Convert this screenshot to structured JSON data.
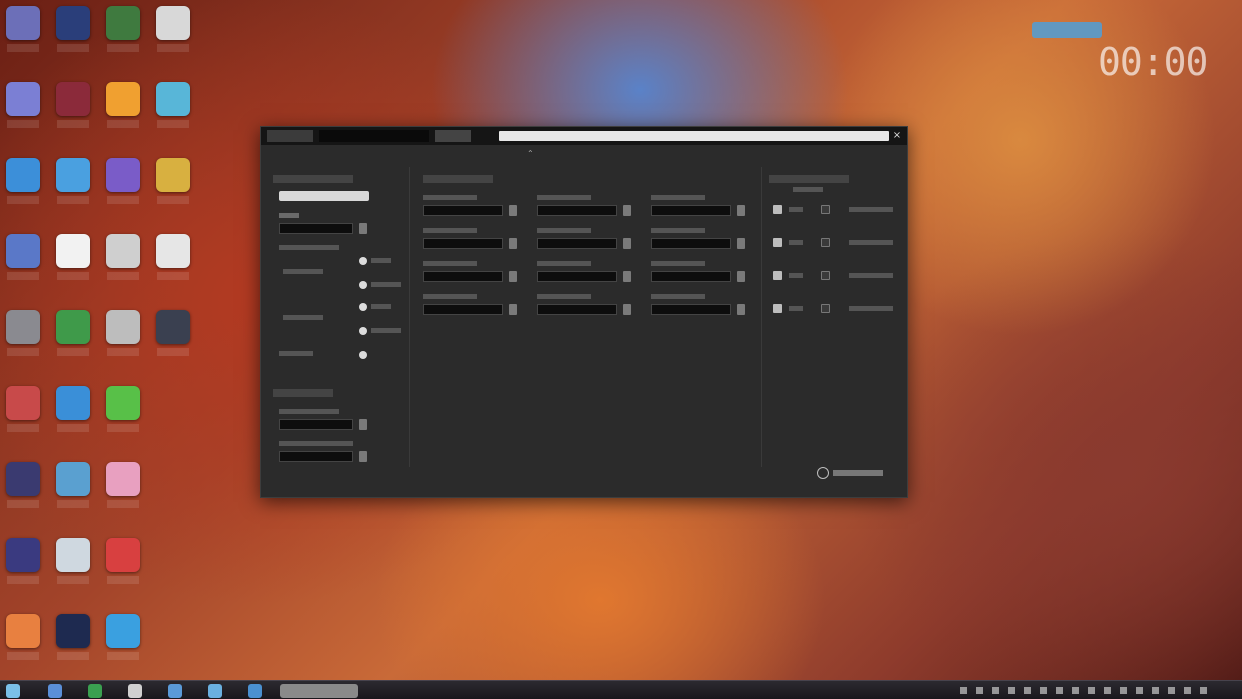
{
  "desktop": {
    "icons": [
      {
        "col": 0,
        "row": 0,
        "color": "#6c6fb8"
      },
      {
        "col": 1,
        "row": 0,
        "color": "#2a3e7a"
      },
      {
        "col": 2,
        "row": 0,
        "color": "#3f7a3f"
      },
      {
        "col": 3,
        "row": 0,
        "color": "#d8d8d8"
      },
      {
        "col": 0,
        "row": 1,
        "color": "#7b7fd4"
      },
      {
        "col": 1,
        "row": 1,
        "color": "#8b2a3a"
      },
      {
        "col": 2,
        "row": 1,
        "color": "#f0a030"
      },
      {
        "col": 3,
        "row": 1,
        "color": "#58b6d8"
      },
      {
        "col": 0,
        "row": 2,
        "color": "#3c8fd9"
      },
      {
        "col": 1,
        "row": 2,
        "color": "#4aa0e0"
      },
      {
        "col": 2,
        "row": 2,
        "color": "#7a5cc8"
      },
      {
        "col": 3,
        "row": 2,
        "color": "#d8b040"
      },
      {
        "col": 0,
        "row": 3,
        "color": "#5a78c8"
      },
      {
        "col": 1,
        "row": 3,
        "color": "#f2f2f2"
      },
      {
        "col": 2,
        "row": 3,
        "color": "#cfcfcf"
      },
      {
        "col": 3,
        "row": 3,
        "color": "#e6e6e6"
      },
      {
        "col": 0,
        "row": 4,
        "color": "#8a8a90"
      },
      {
        "col": 1,
        "row": 4,
        "color": "#3f9a4a"
      },
      {
        "col": 2,
        "row": 4,
        "color": "#bdbdbd"
      },
      {
        "col": 3,
        "row": 4,
        "color": "#3a4050"
      },
      {
        "col": 0,
        "row": 5,
        "color": "#c84a4a"
      },
      {
        "col": 1,
        "row": 5,
        "color": "#3a8fd8"
      },
      {
        "col": 2,
        "row": 5,
        "color": "#58c048"
      },
      {
        "col": 0,
        "row": 6,
        "color": "#3a3a70"
      },
      {
        "col": 1,
        "row": 6,
        "color": "#5aa0d0"
      },
      {
        "col": 2,
        "row": 6,
        "color": "#e8a0c0"
      },
      {
        "col": 0,
        "row": 7,
        "color": "#3a3a80"
      },
      {
        "col": 1,
        "row": 7,
        "color": "#cfd8e0"
      },
      {
        "col": 2,
        "row": 7,
        "color": "#d84040"
      },
      {
        "col": 0,
        "row": 8,
        "color": "#e88040"
      },
      {
        "col": 1,
        "row": 8,
        "color": "#1e2a50"
      },
      {
        "col": 2,
        "row": 8,
        "color": "#3aa0e0"
      }
    ]
  },
  "overlay": {
    "clock": "00:00"
  },
  "window": {
    "close_glyph": "×",
    "collapse_glyph": "⌃"
  },
  "taskbar": {
    "items": [
      "#5a8fd8",
      "#3aa050",
      "#d0d0d0",
      "#5a9ad8",
      "#6ab0e0",
      "#4a90d0",
      "#a0a0a0"
    ]
  }
}
